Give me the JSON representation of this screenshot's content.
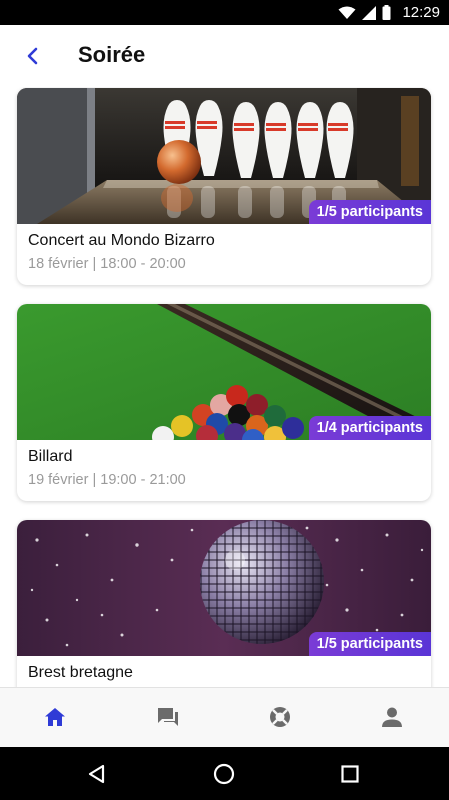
{
  "status": {
    "time": "12:29"
  },
  "header": {
    "title": "Soirée"
  },
  "events": [
    {
      "title": "Concert au Mondo Bizarro",
      "meta": "18 février | 18:00 - 20:00",
      "participants": "1/5 participants",
      "image": "bowling-image"
    },
    {
      "title": "Billard",
      "meta": "19 février | 19:00 - 21:00",
      "participants": "1/4 participants",
      "image": "billiards-image"
    },
    {
      "title": "Brest bretagne",
      "meta": "",
      "participants": "1/5 participants",
      "image": "disco-ball-image"
    }
  ],
  "bottom_nav": [
    {
      "icon": "home-icon",
      "active": true
    },
    {
      "icon": "chat-icon",
      "active": false
    },
    {
      "icon": "help-icon",
      "active": false
    },
    {
      "icon": "profile-icon",
      "active": false
    }
  ],
  "colors": {
    "accent": "#2f3bd6",
    "badge": "#6a3ad6",
    "inactive_icon": "#6b6b6b"
  }
}
